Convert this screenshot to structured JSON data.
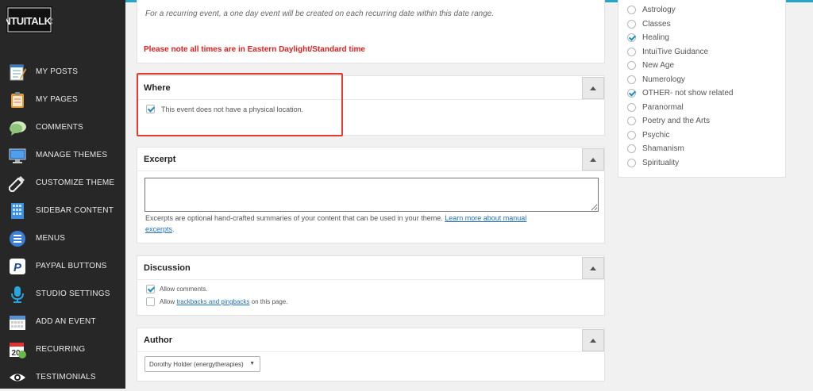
{
  "logo_text": "INTUITALKS",
  "sidebar": {
    "items": [
      {
        "label": "MY POSTS",
        "icon": "notepad-icon"
      },
      {
        "label": "MY PAGES",
        "icon": "clipboard-icon"
      },
      {
        "label": "COMMENTS",
        "icon": "speech-bubble-icon"
      },
      {
        "label": "MANAGE THEMES",
        "icon": "monitor-icon"
      },
      {
        "label": "CUSTOMIZE THEME",
        "icon": "eyedropper-icon"
      },
      {
        "label": "SIDEBAR CONTENT",
        "icon": "sidebar-grid-icon"
      },
      {
        "label": "MENUS",
        "icon": "menu-lines-icon"
      },
      {
        "label": "PAYPAL BUTTONS",
        "icon": "paypal-icon"
      },
      {
        "label": "STUDIO SETTINGS",
        "icon": "microphone-icon"
      },
      {
        "label": "ADD AN EVENT",
        "icon": "calendar-icon"
      },
      {
        "label": "RECURRING",
        "icon": "recurring-calendar-icon"
      },
      {
        "label": "TESTIMONIALS",
        "icon": "eye-icon"
      }
    ]
  },
  "recurring_note": "For a recurring event, a one day event will be created on each recurring date within this date range.",
  "timezone_warning": "Please note all times are in Eastern Daylight/Standard time",
  "where": {
    "title": "Where",
    "no_location_label": "This event does not have a physical location.",
    "no_location_checked": true
  },
  "excerpt": {
    "title": "Excerpt",
    "help_text": "Excerpts are optional hand-crafted summaries of your content that can be used in your theme.",
    "link_text_1": "Learn more about manual",
    "link_text_2": "excerpts",
    "trailing": "."
  },
  "discussion": {
    "title": "Discussion",
    "allow_comments": "Allow comments.",
    "allow_prefix": "Allow",
    "trackbacks_link": "trackbacks and pingbacks",
    "allow_suffix": "on this page."
  },
  "author": {
    "title": "Author",
    "selected": "Dorothy Holder (energytherapies)",
    "arrow": "▼"
  },
  "categories": [
    {
      "label": "Astrology",
      "checked": false
    },
    {
      "label": "Classes",
      "checked": false
    },
    {
      "label": "Healing",
      "checked": true
    },
    {
      "label": "IntuiTive Guidance",
      "checked": false
    },
    {
      "label": "New Age",
      "checked": false
    },
    {
      "label": "Numerology",
      "checked": false
    },
    {
      "label": "OTHER- not show related",
      "checked": true
    },
    {
      "label": "Paranormal",
      "checked": false
    },
    {
      "label": "Poetry and the Arts",
      "checked": false
    },
    {
      "label": "Psychic",
      "checked": false
    },
    {
      "label": "Shamanism",
      "checked": false
    },
    {
      "label": "Spirituality",
      "checked": false
    }
  ],
  "colors": {
    "accent": "#2aa3c9",
    "sidebar_bg": "#272727",
    "warning": "#e02020",
    "highlight": "#e53a2f"
  }
}
